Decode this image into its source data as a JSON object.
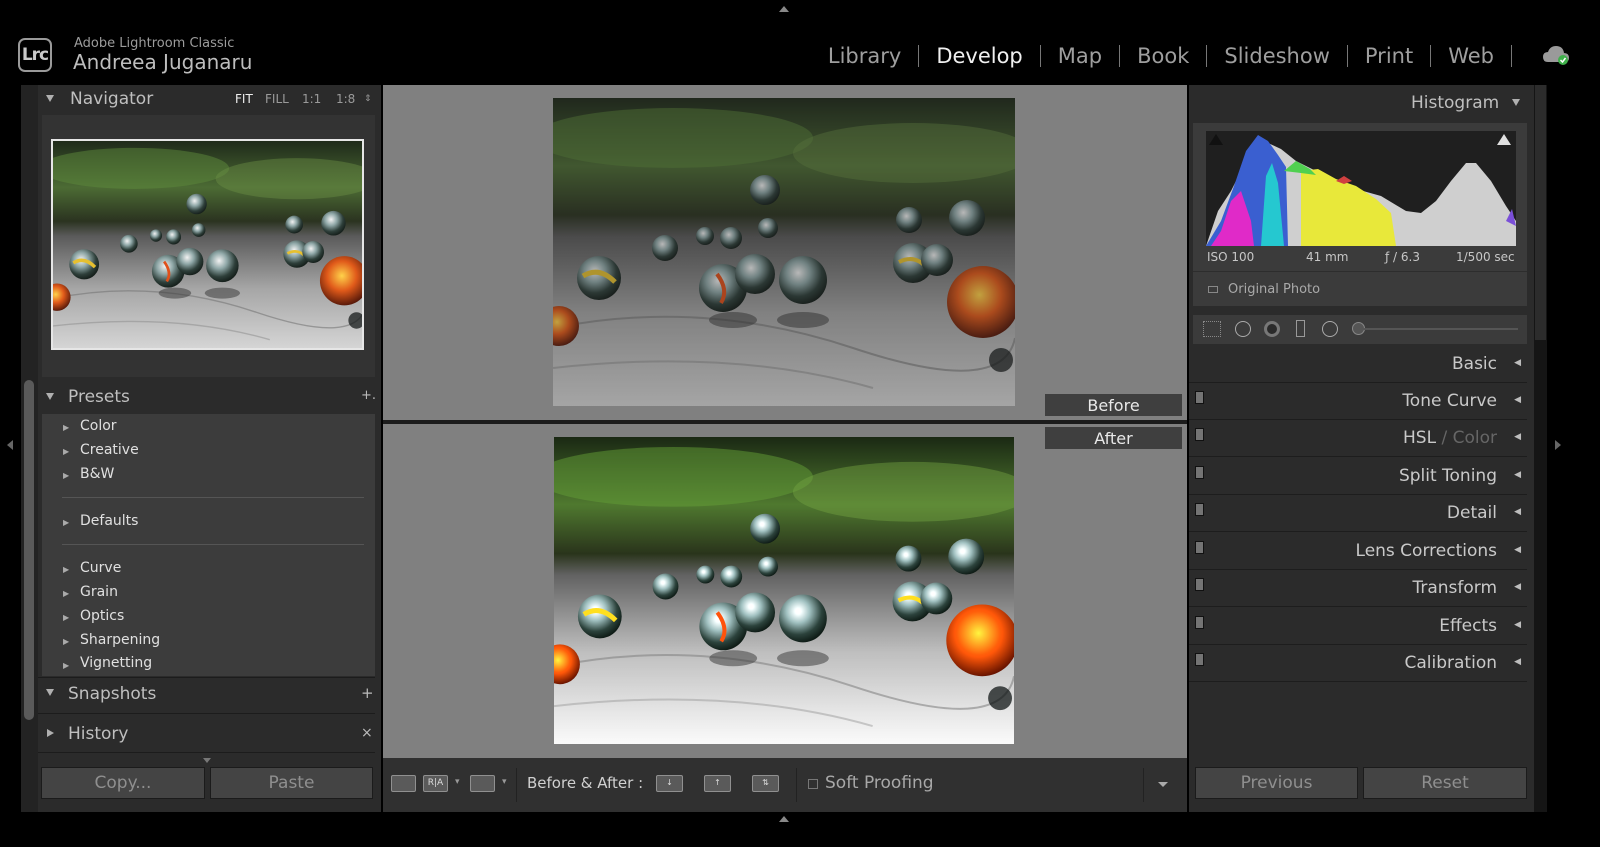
{
  "header": {
    "logo": "Lrc",
    "app_name": "Adobe Lightroom Classic",
    "user_name": "Andreea Juganaru",
    "modules": [
      {
        "label": "Library",
        "active": false
      },
      {
        "label": "Develop",
        "active": true
      },
      {
        "label": "Map",
        "active": false
      },
      {
        "label": "Book",
        "active": false
      },
      {
        "label": "Slideshow",
        "active": false
      },
      {
        "label": "Print",
        "active": false
      },
      {
        "label": "Web",
        "active": false
      }
    ],
    "cloud_icon": "cloud-sync-icon"
  },
  "left_panel": {
    "navigator": {
      "title": "Navigator",
      "zoom_options": [
        "FIT",
        "FILL",
        "1:1",
        "1:8"
      ],
      "active_zoom": "FIT"
    },
    "presets": {
      "title": "Presets",
      "add_symbol": "+.",
      "groups": [
        [
          "Color",
          "Creative",
          "B&W"
        ],
        [
          "Defaults"
        ],
        [
          "Curve",
          "Grain",
          "Optics",
          "Sharpening",
          "Vignetting"
        ]
      ]
    },
    "snapshots": {
      "title": "Snapshots",
      "add_symbol": "+"
    },
    "history": {
      "title": "History",
      "clear_symbol": "×"
    },
    "copy_label": "Copy...",
    "paste_label": "Paste"
  },
  "center": {
    "before_label": "Before",
    "after_label": "After"
  },
  "toolbar": {
    "before_after_label": "Before & After :",
    "soft_proofing_label": "Soft Proofing",
    "soft_proofing_checked": false
  },
  "right_panel": {
    "histogram": {
      "title": "Histogram",
      "iso": "ISO 100",
      "focal_length": "41 mm",
      "aperture": "ƒ / 6.3",
      "shutter": "1/500 sec",
      "original_photo_label": "Original Photo"
    },
    "sections": [
      "Basic",
      "Tone Curve",
      "HSL",
      "Color",
      "Split Toning",
      "Detail",
      "Lens Corrections",
      "Transform",
      "Effects",
      "Calibration"
    ],
    "hsl_separator": " / ",
    "previous_label": "Previous",
    "reset_label": "Reset"
  },
  "colors": {
    "app_bg": "#000000",
    "panel_bg": "#2b2b2b",
    "center_bg": "#808080",
    "active_module": "#f0f0f0",
    "inactive_module": "#9e9e9e",
    "hist_blue": "#3a5fd0",
    "hist_magenta": "#e02ac8",
    "hist_cyan": "#25c8d0",
    "hist_yellow": "#e8e83a",
    "hist_green": "#50d050",
    "hist_red": "#d04040"
  }
}
